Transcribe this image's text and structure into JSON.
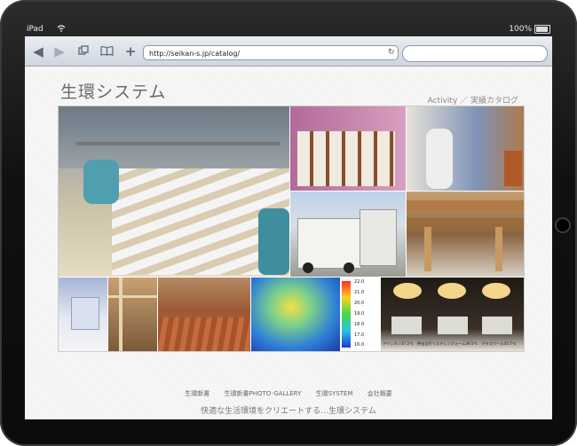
{
  "status_bar": {
    "device": "iPad",
    "battery": "100%"
  },
  "browser": {
    "url": "http://seikan-s.jp/catalog/",
    "icons": [
      "back-icon",
      "forward-icon",
      "pages-icon",
      "bookmarks-icon",
      "add-icon",
      "reload-icon"
    ]
  },
  "page": {
    "title": "生環システム",
    "subtitle": "Activity ／ 実績カタログ",
    "gallery_captions": {
      "thermo_scale": [
        "22.0",
        "21.0",
        "20.0",
        "19.0",
        "18.0",
        "17.0",
        "16.0"
      ],
      "insulation_labels": "アイシネン37.2℃　押出法ポリスチレンフォーム39.5℃　グラスウール43.7℃"
    },
    "nav": [
      "生環新書",
      "生環新書PHOTO-GALLERY",
      "生環SYSTEM",
      "会社概要"
    ],
    "tagline": "快適な生活環境をクリエートする…生環システム"
  },
  "colors": {
    "accent": "#6a6a6a",
    "toolbar": "#d6dce3"
  }
}
